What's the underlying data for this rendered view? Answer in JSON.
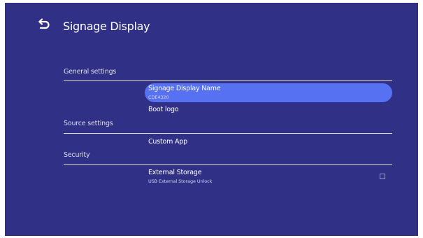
{
  "header": {
    "title": "Signage Display",
    "back_icon": "back-arrow-icon"
  },
  "categories": [
    {
      "label": "General settings"
    },
    {
      "label": "Source settings"
    },
    {
      "label": "Security"
    }
  ],
  "items": [
    {
      "title": "Signage Display Name",
      "subtitle": "CDE4320",
      "selected": true
    },
    {
      "title": "Boot logo",
      "subtitle": ""
    },
    {
      "title": "Custom App",
      "subtitle": ""
    },
    {
      "title": "External Storage",
      "subtitle": "USB External Storage Unlock",
      "checked": false
    }
  ],
  "colors": {
    "background": "#303186",
    "highlight": "#5671f1",
    "text": "#ffffff",
    "divider": "#e8e8f2"
  }
}
